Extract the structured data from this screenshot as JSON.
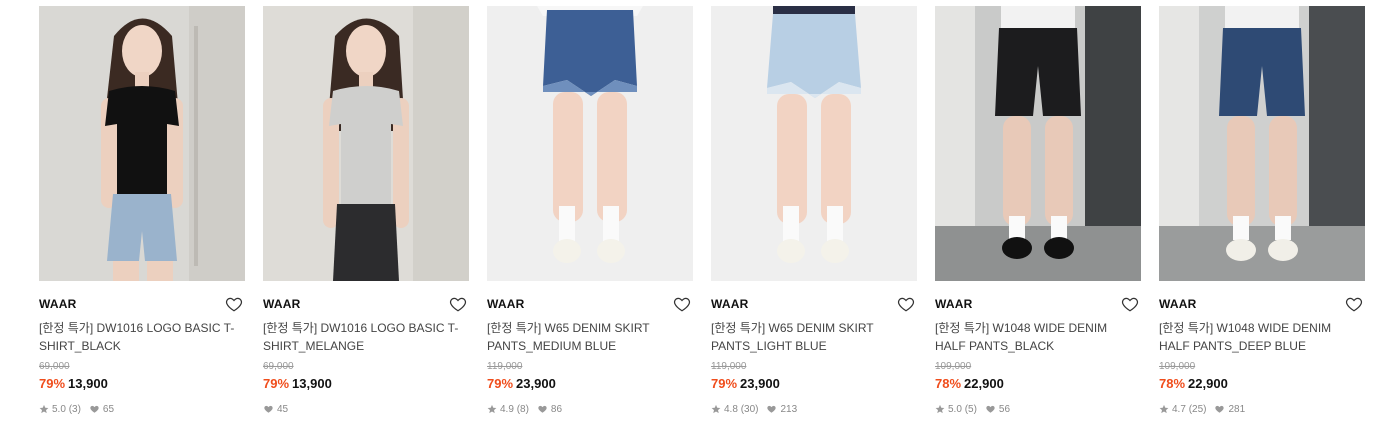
{
  "products": [
    {
      "brand": "WAAR",
      "title": "[한정 특가] DW1016 LOGO BASIC T-SHIRT_BLACK",
      "original_price": "69,000",
      "discount": "79%",
      "price": "13,900",
      "rating": "5.0",
      "review_count": "(3)",
      "likes": "65",
      "image": "model-black-tshirt-denim-shorts"
    },
    {
      "brand": "WAAR",
      "title": "[한정 특가] DW1016 LOGO BASIC T-SHIRT_MELANGE",
      "original_price": "69,000",
      "discount": "79%",
      "price": "13,900",
      "rating": "",
      "review_count": "",
      "likes": "45",
      "image": "model-grey-tshirt-black-denim"
    },
    {
      "brand": "WAAR",
      "title": "[한정 특가] W65 DENIM SKIRT PANTS_MEDIUM BLUE",
      "original_price": "119,000",
      "discount": "79%",
      "price": "23,900",
      "rating": "4.9",
      "review_count": "(8)",
      "likes": "86",
      "image": "medium-blue-denim-skirt-pants"
    },
    {
      "brand": "WAAR",
      "title": "[한정 특가] W65 DENIM SKIRT PANTS_LIGHT BLUE",
      "original_price": "119,000",
      "discount": "79%",
      "price": "23,900",
      "rating": "4.8",
      "review_count": "(30)",
      "likes": "213",
      "image": "light-blue-denim-skirt-pants"
    },
    {
      "brand": "WAAR",
      "title": "[한정 특가] W1048 WIDE DENIM HALF PANTS_BLACK",
      "original_price": "109,000",
      "discount": "78%",
      "price": "22,900",
      "rating": "5.0",
      "review_count": "(5)",
      "likes": "56",
      "image": "black-wide-denim-half-pants"
    },
    {
      "brand": "WAAR",
      "title": "[한정 특가] W1048 WIDE DENIM HALF PANTS_DEEP BLUE",
      "original_price": "109,000",
      "discount": "78%",
      "price": "22,900",
      "rating": "4.7",
      "review_count": "(25)",
      "likes": "281",
      "image": "deep-blue-wide-denim-half-pants"
    }
  ],
  "colors": {
    "discount": "#f04d1c",
    "brand": "#111111",
    "muted": "#888888"
  }
}
